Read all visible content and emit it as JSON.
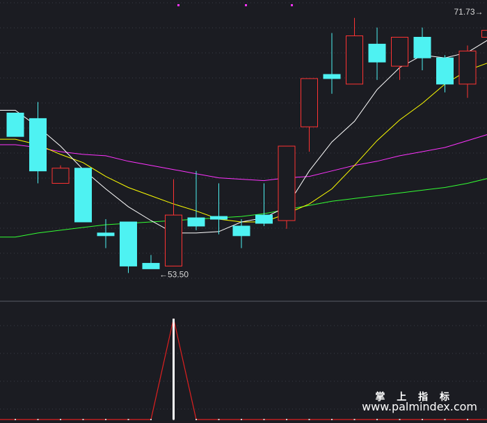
{
  "chart_data": [
    {
      "type": "candlestick",
      "title": "",
      "ylim": [
        51.5,
        73.0
      ],
      "grid": true,
      "colors": {
        "up": "#ff3333",
        "down": "#4ef2f2",
        "ma5": "#ffffff",
        "ma10": "#ffff00",
        "ma20": "#ff33ff",
        "ma60": "#33ff33"
      },
      "candles": [
        {
          "o": 64.8,
          "h": 64.8,
          "c": 63.1,
          "l": 63.1
        },
        {
          "o": 64.4,
          "h": 65.6,
          "c": 60.6,
          "l": 59.7
        },
        {
          "o": 59.7,
          "h": 61.0,
          "c": 60.8,
          "l": 59.7
        },
        {
          "o": 60.8,
          "h": 60.8,
          "c": 56.9,
          "l": 56.9
        },
        {
          "o": 56.1,
          "h": 57.1,
          "c": 55.9,
          "l": 55.0
        },
        {
          "o": 56.9,
          "h": 56.9,
          "c": 53.7,
          "l": 53.2
        },
        {
          "o": 53.9,
          "h": 54.5,
          "c": 53.5,
          "l": 53.5
        },
        {
          "o": 53.7,
          "h": 60.0,
          "c": 57.4,
          "l": 53.7
        },
        {
          "o": 57.2,
          "h": 60.6,
          "c": 56.6,
          "l": 56.3
        },
        {
          "o": 57.3,
          "h": 59.7,
          "c": 57.1,
          "l": 56.0
        },
        {
          "o": 56.6,
          "h": 57.1,
          "c": 55.9,
          "l": 55.0
        },
        {
          "o": 57.4,
          "h": 59.7,
          "c": 56.8,
          "l": 56.6
        },
        {
          "o": 57.0,
          "h": 62.4,
          "c": 62.4,
          "l": 56.4
        },
        {
          "o": 63.8,
          "h": 67.2,
          "c": 67.3,
          "l": 62.0
        },
        {
          "o": 67.6,
          "h": 70.6,
          "c": 67.3,
          "l": 66.2
        },
        {
          "o": 66.9,
          "h": 71.7,
          "c": 70.4,
          "l": 66.9
        },
        {
          "o": 69.8,
          "h": 71.0,
          "c": 68.5,
          "l": 67.2
        },
        {
          "o": 68.2,
          "h": 70.3,
          "c": 70.3,
          "l": 67.2
        },
        {
          "o": 70.3,
          "h": 71.0,
          "c": 68.8,
          "l": 67.9
        },
        {
          "o": 68.8,
          "h": 69.0,
          "c": 66.9,
          "l": 66.3
        },
        {
          "o": 66.9,
          "h": 69.7,
          "c": 69.3,
          "l": 65.9
        },
        {
          "o": 70.3,
          "h": 71.73,
          "c": 70.8,
          "l": 69.7
        }
      ],
      "ma5": [
        65.0,
        63.8,
        62.4,
        60.7,
        59.3,
        58.0,
        57.0,
        56.1,
        56.1,
        56.2,
        56.9,
        57.2,
        58.0,
        60.6,
        62.7,
        64.2,
        66.5,
        68.1,
        69.0,
        68.8,
        69.2,
        70.2
      ],
      "ma10": [
        62.9,
        62.5,
        61.8,
        61.2,
        60.2,
        59.4,
        58.8,
        58.2,
        57.7,
        57.1,
        56.9,
        56.9,
        57.5,
        58.2,
        59.3,
        61.0,
        62.8,
        64.3,
        65.5,
        66.9,
        67.9,
        68.5
      ],
      "ma20": [
        62.5,
        62.3,
        62.0,
        61.8,
        61.7,
        61.3,
        61.0,
        60.7,
        60.4,
        60.1,
        60.0,
        59.9,
        60.1,
        60.2,
        60.6,
        61.0,
        61.3,
        61.7,
        62.0,
        62.3,
        62.8,
        63.3
      ],
      "ma60": [
        55.8,
        56.1,
        56.3,
        56.5,
        56.7,
        56.8,
        56.9,
        57.0,
        57.1,
        57.2,
        57.3,
        57.5,
        57.8,
        58.1,
        58.4,
        58.6,
        58.8,
        59.0,
        59.2,
        59.4,
        59.7,
        60.1
      ],
      "annotations": [
        {
          "label": "53.50",
          "index": 6
        },
        {
          "label": "71.73",
          "index": 21
        }
      ]
    },
    {
      "type": "line",
      "ylim": [
        0,
        1
      ],
      "values": [
        0,
        0,
        0,
        0,
        0,
        0,
        0,
        1,
        0,
        0,
        0,
        0,
        0,
        0,
        0,
        0,
        0,
        0,
        0,
        0,
        0,
        0
      ],
      "signal_index": 7
    }
  ],
  "watermark": {
    "cn": "掌 上 指 标",
    "url": "www.palmindex.com"
  }
}
